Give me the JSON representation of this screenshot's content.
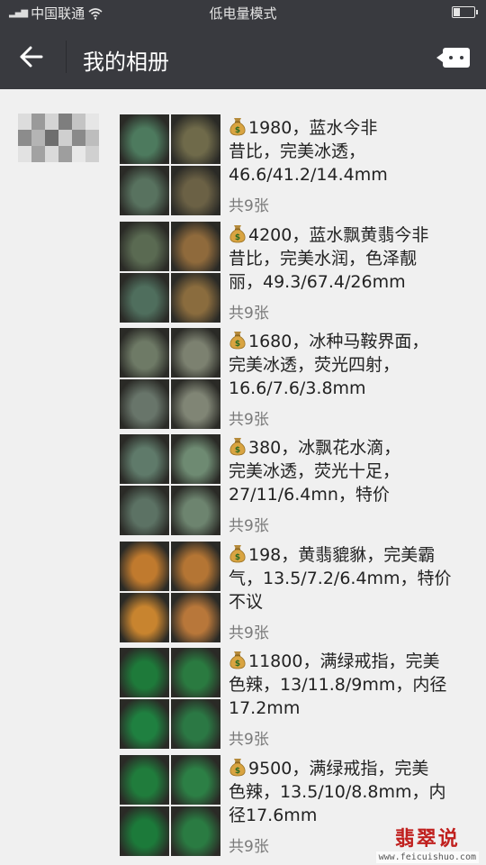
{
  "status_bar": {
    "carrier": "中国联通",
    "mode": "低电量模式"
  },
  "header": {
    "title": "我的相册"
  },
  "posts": [
    {
      "line1": "1980，蓝水今非",
      "line2": "昔比，完美冰透，",
      "line3": "46.6/41.2/14.4mm",
      "count": "共9张",
      "thumb_colors": [
        "#4d7a5e",
        "#6f6a4a",
        "#58725f",
        "#6b6145"
      ]
    },
    {
      "line1": "4200，蓝水飘黄翡今非",
      "line2": "昔比，完美水润，色泽靓",
      "line3": "丽，49.3/67.4/26mm",
      "count": "共9张",
      "thumb_colors": [
        "#5a6a52",
        "#8f6a3c",
        "#4f6e5d",
        "#8a6c3e"
      ]
    },
    {
      "line1": "1680，冰种马鞍界面，",
      "line2": "完美冰透，荧光四射，",
      "line3": "16.6/7.6/3.8mm",
      "count": "共9张",
      "thumb_colors": [
        "#6e7a66",
        "#7c8170",
        "#68756a",
        "#808575"
      ]
    },
    {
      "line1": "380，冰飘花水滴，",
      "line2": "完美冰透，荧光十足，",
      "line3": "27/11/6.4mn，特价",
      "count": "共9张",
      "thumb_colors": [
        "#5f7a6a",
        "#6e8a72",
        "#5c7264",
        "#6d846f"
      ]
    },
    {
      "line1": "198，黄翡貔貅，完美霸",
      "line2": "气，13.5/7.2/6.4mm，特价",
      "line3": "不议",
      "count": "共9张",
      "thumb_colors": [
        "#c07a2e",
        "#b47534",
        "#c8842f",
        "#b8773a"
      ]
    },
    {
      "line1": "11800，满绿戒指，完美",
      "line2": "色辣，13/11.8/9mm，内径",
      "line3": "17.2mm",
      "count": "共9张",
      "thumb_colors": [
        "#1e7a3a",
        "#2a7a40",
        "#1f8040",
        "#2b7844"
      ]
    },
    {
      "line1": "9500，满绿戒指，完美",
      "line2": "色辣，13.5/10/8.8mm，内",
      "line3": "径17.6mm",
      "count": "共9张",
      "thumb_colors": [
        "#207c3c",
        "#2c7f45",
        "#1c7a3a",
        "#2a7b42"
      ]
    }
  ],
  "watermark": {
    "logo": "翡翠说",
    "url": "www.feicuishuo.com"
  },
  "colors": {
    "header_bg": "#393a3f",
    "page_bg": "#f0f0f0",
    "count_text": "#7a7a7a"
  },
  "icons": [
    "back-arrow-icon",
    "more-message-icon",
    "money-bag-icon",
    "wifi-icon",
    "battery-icon"
  ]
}
